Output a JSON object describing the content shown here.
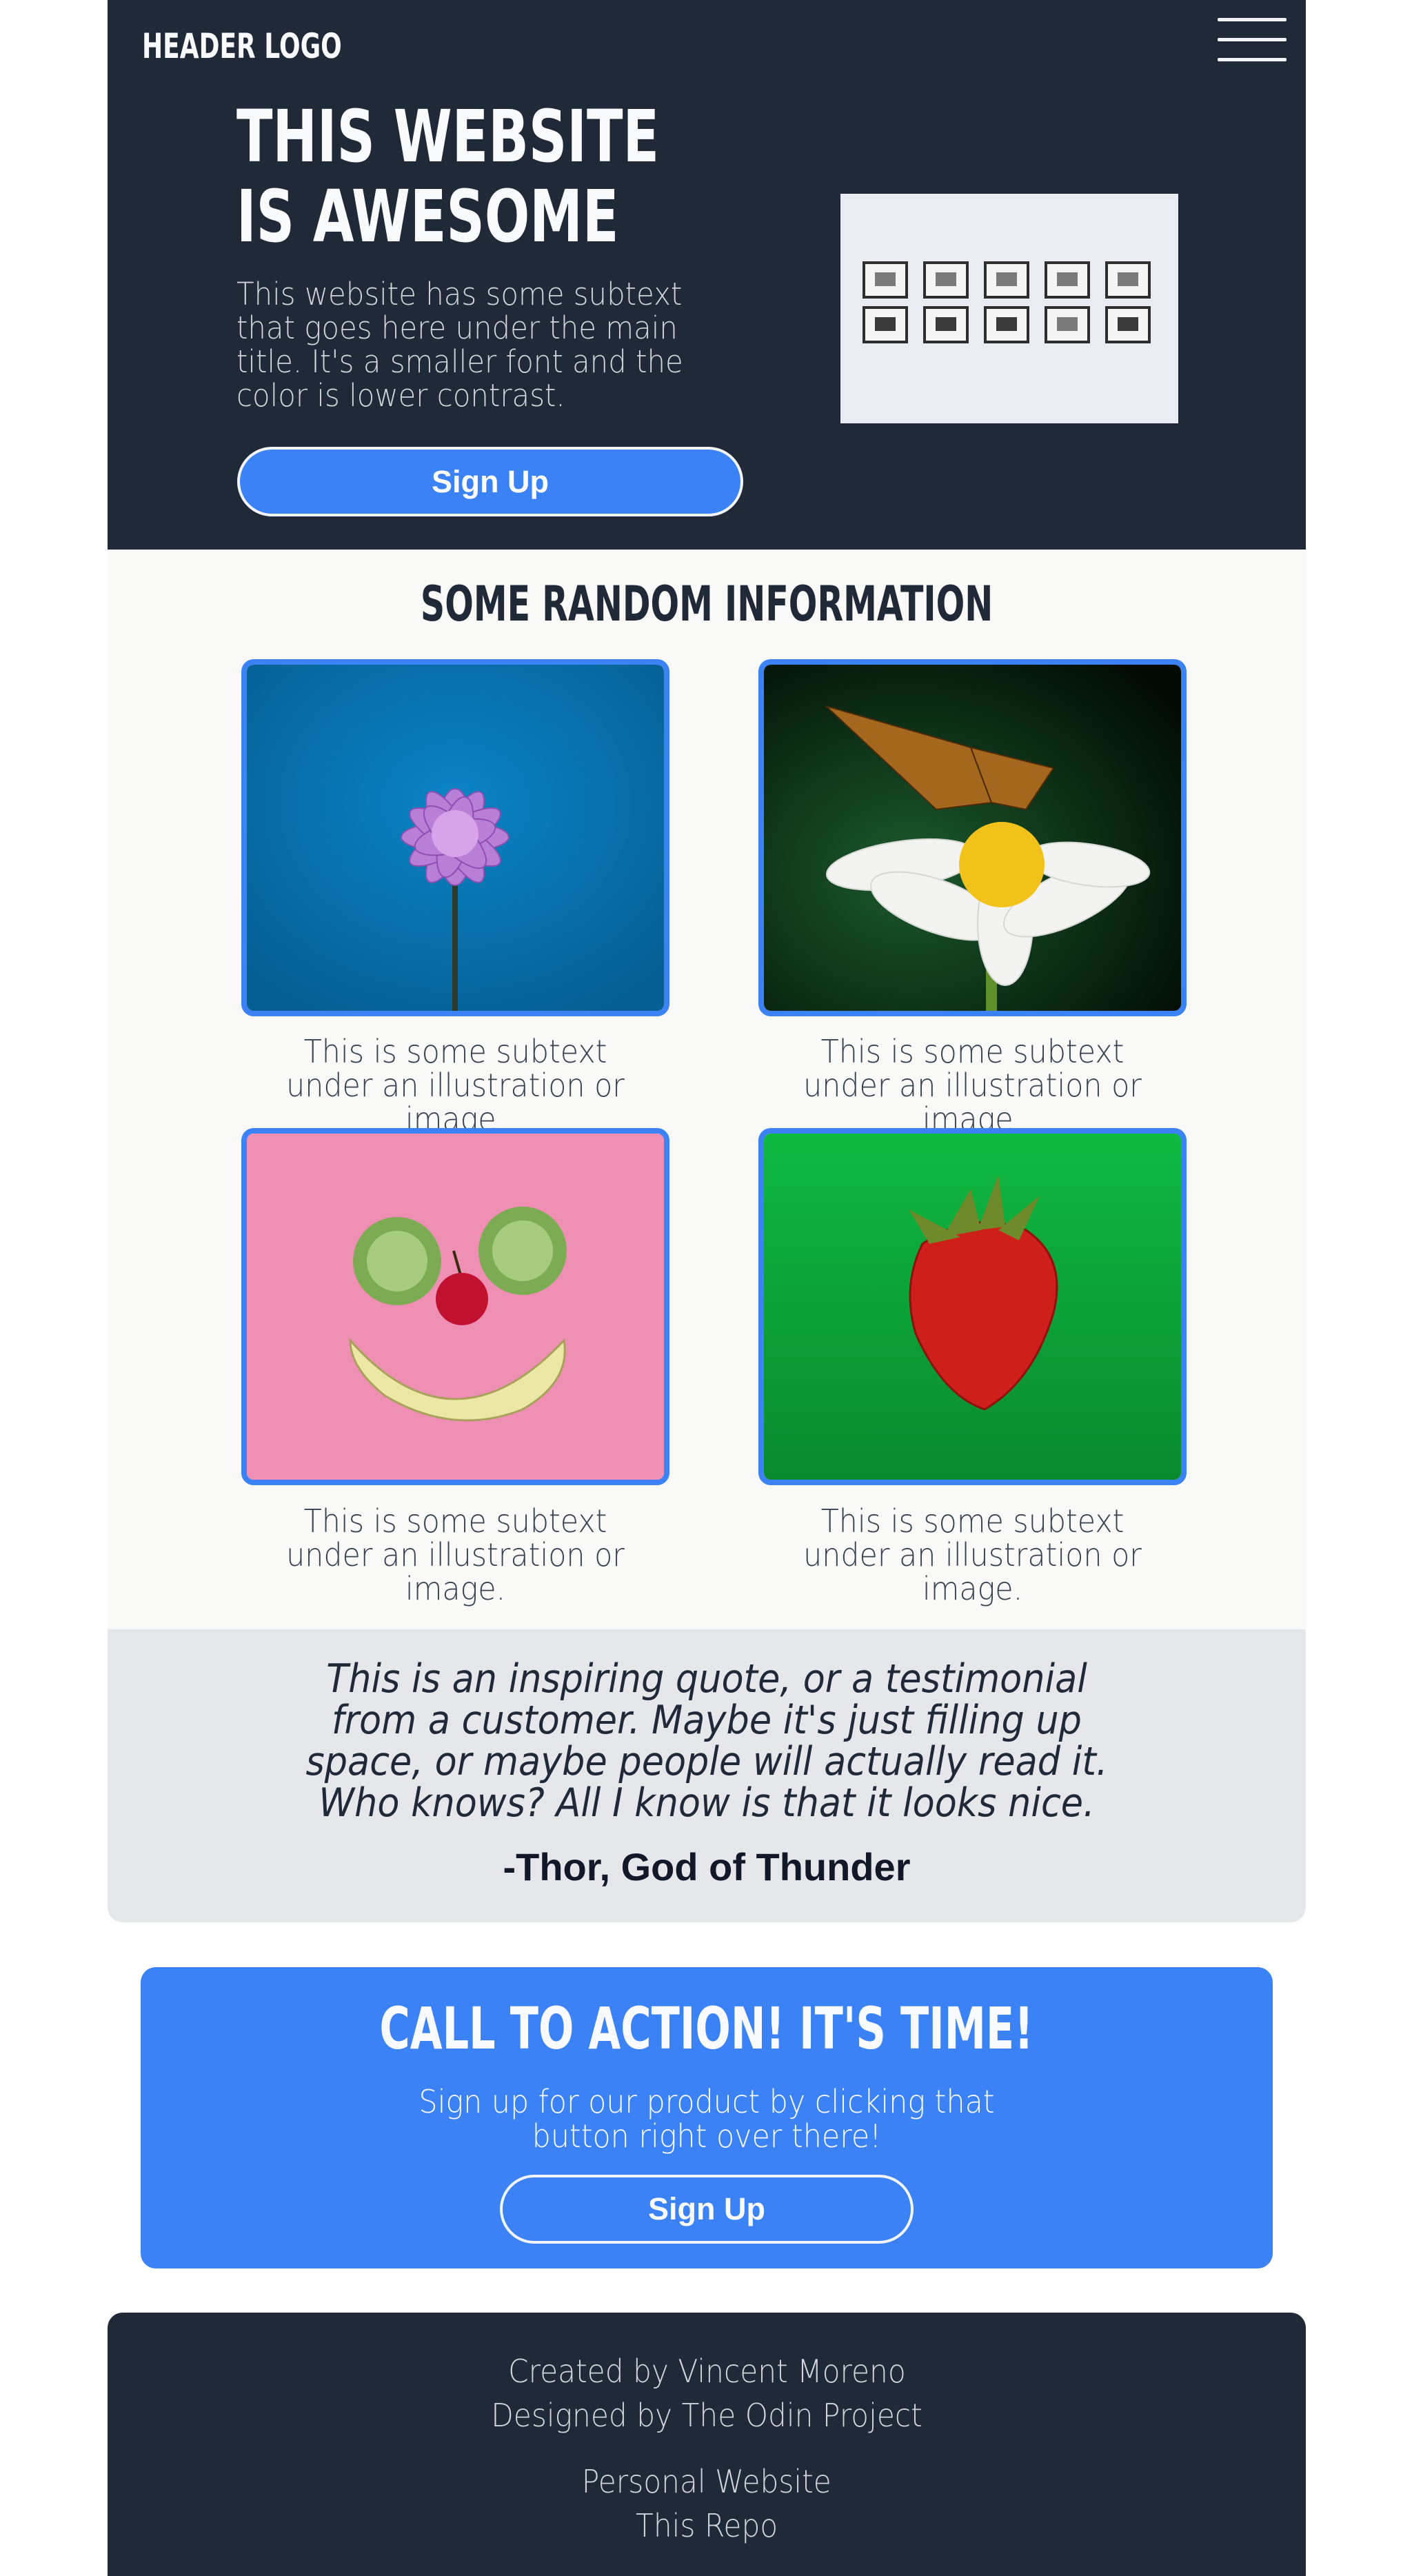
{
  "header": {
    "logo": "HEADER LOGO",
    "menu_icon": "hamburger-menu-icon",
    "title": "THIS WEBSITE IS AWESOME",
    "subtext": "This website has some subtext that goes here under the main title. It's a smaller font and the color is lower contrast.",
    "signup_label": "Sign Up",
    "hero_image": "framed-pictures-on-wall-photo"
  },
  "info": {
    "title": "SOME RANDOM INFORMATION",
    "cards": [
      {
        "image": "purple-flower-photo",
        "caption": "This is some subtext under an illustration or image."
      },
      {
        "image": "butterfly-on-daisy-photo",
        "caption": "This is some subtext under an illustration or image."
      },
      {
        "image": "fruit-smiley-face-photo",
        "caption": "This is some subtext under an illustration or image."
      },
      {
        "image": "strawberry-on-green-photo",
        "caption": "This is some subtext under an illustration or image."
      }
    ]
  },
  "quote": {
    "text": "This is an inspiring quote, or a testimonial from a customer. Maybe it's just filling up space, or maybe people will actually read it. Who knows? All I know is that it looks nice.",
    "author": "-Thor, God of Thunder"
  },
  "cta": {
    "title": "CALL TO ACTION! IT'S TIME!",
    "text": "Sign up for our product by clicking that button right over there!",
    "signup_label": "Sign Up"
  },
  "footer": {
    "created_by": "Created by Vincent Moreno",
    "designed_by": "Designed by The Odin Project",
    "personal_website": "Personal Website",
    "repo": "This Repo"
  },
  "colors": {
    "dark": "#1f2937",
    "accent": "#3b82f6",
    "light_bg": "#f9f9f7",
    "quote_bg": "#e5e7eb"
  }
}
